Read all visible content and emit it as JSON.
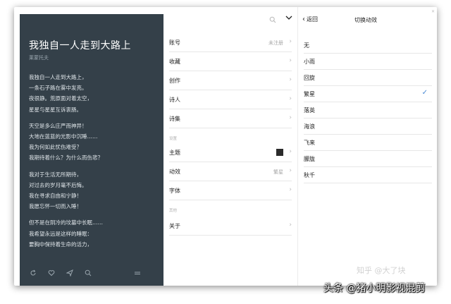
{
  "poem": {
    "title": "我独自一人走到大路上",
    "author": "莱蒙托夫",
    "stanzas": [
      [
        "我独自一人走到大路上，",
        "一条石子路在雾中发亮。",
        "夜很静。荒原面对着太空，",
        "星星与星星互诉衷肠。"
      ],
      [
        "天空是多么庄严而神异！",
        "大地在蓝蓝的光影中沉睡……",
        "我为何如此忧伤难受？",
        "我期待着什么？为什么而伤悲？"
      ],
      [
        "我对于生活无所期待，",
        "对过去的岁月毫不后悔。",
        "我在寻求自由和宁静！",
        "我愿忘怀一切而入睡！"
      ],
      [
        "但不是在阴冷的坟墓中长眠……",
        "我希望永远是这样的睡眠：",
        "要胸中保持着生命的活力，"
      ]
    ],
    "toolbar_icons": [
      "refresh-icon",
      "heart-icon",
      "send-icon",
      "search-icon",
      "menu-icon"
    ]
  },
  "menu": {
    "header_icons": [
      "search-icon",
      "chevron-down-icon"
    ],
    "items": [
      {
        "label": "账号",
        "value": "未注册"
      },
      {
        "label": "收藏",
        "value": ""
      },
      {
        "label": "创作",
        "value": ""
      },
      {
        "label": "诗人",
        "value": ""
      },
      {
        "label": "诗集",
        "value": ""
      }
    ],
    "section_settings": "设置",
    "settings_items": [
      {
        "label": "主题",
        "value": "",
        "swatch_color": "#2b2b2b"
      },
      {
        "label": "动效",
        "value": "繁星"
      },
      {
        "label": "字体",
        "value": ""
      }
    ],
    "section_other": "其他",
    "other_items": [
      {
        "label": "关于",
        "value": ""
      }
    ]
  },
  "effect": {
    "back_label": "返回",
    "title": "切换动效",
    "options": [
      "无",
      "小雨",
      "回旋",
      "繁星",
      "落英",
      "海浪",
      "飞来",
      "朦胧",
      "秋千"
    ],
    "selected": "繁星",
    "check_color": "#4a8ad4"
  },
  "watermark": {
    "faint": "知乎 @大了块",
    "main": "头条 @猪小明影视混剪"
  }
}
